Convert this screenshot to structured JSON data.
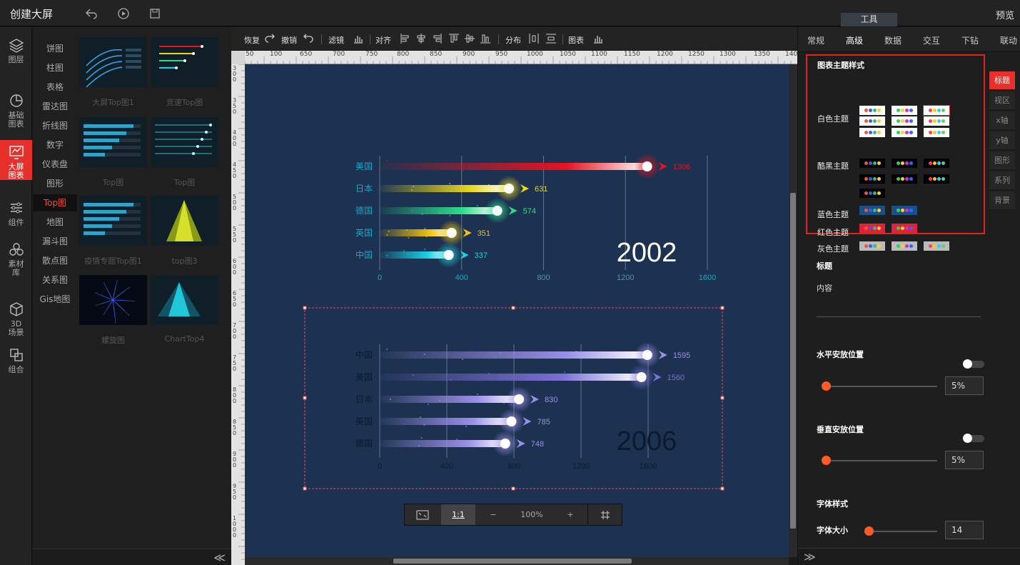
{
  "app": {
    "title": "创建大屏",
    "preview": "预览",
    "tools_tab": "工具",
    "undo_icon": "undo-icon",
    "play_icon": "play-icon",
    "save_icon": "save-icon"
  },
  "leftnav": [
    {
      "label": "图层",
      "icon": "layers-icon"
    },
    {
      "label": "基础图表",
      "icon": "clock-chart-icon"
    },
    {
      "label": "大屏图表",
      "icon": "screen-chart-icon",
      "active": true
    },
    {
      "label": "组件",
      "icon": "sliders-icon"
    },
    {
      "label": "素材库",
      "icon": "material-icon"
    },
    {
      "label": "3D场景",
      "icon": "cube-icon"
    },
    {
      "label": "组合",
      "icon": "group-icon"
    }
  ],
  "categories": [
    "饼图",
    "柱图",
    "表格",
    "雷达图",
    "折线图",
    "数字",
    "仪表盘",
    "图形",
    "Top图",
    "地图",
    "漏斗图",
    "散点图",
    "关系图",
    "Gis地图"
  ],
  "active_category": "Top图",
  "thumbnails": [
    "大屏Top图1",
    "竞速Top图",
    "Top图",
    "Top图",
    "疫情专题Top图1",
    "top图3",
    "螺旋图",
    "ChartTop4"
  ],
  "toolbar": {
    "redo": "恢复",
    "undo": "撤销",
    "filter": "滤镜",
    "align": "对齐",
    "distribute": "分布",
    "chart": "图表"
  },
  "ruler": {
    "top": [
      "50",
      "100",
      "650",
      "700",
      "750",
      "800",
      "850",
      "900",
      "950",
      "1000",
      "1050",
      "1100",
      "1150",
      "1200",
      "1250",
      "1300",
      "1350",
      "140"
    ],
    "left": [
      "300",
      "350",
      "400",
      "450",
      "500",
      "550",
      "600",
      "650",
      "700",
      "750",
      "800",
      "850",
      "900",
      "950",
      "1000"
    ]
  },
  "zoom": {
    "fit": "fit-screen-icon",
    "one": "1:1",
    "minus": "−",
    "level": "100%",
    "plus": "+",
    "grid": "grid-icon"
  },
  "chart_data": [
    {
      "type": "bar",
      "title": "2002",
      "categories": [
        "美国",
        "日本",
        "德国",
        "英国",
        "中国"
      ],
      "values": [
        1306,
        631,
        574,
        351,
        337
      ],
      "colors": [
        "#e8131f",
        "#e8d61b",
        "#2bdc8a",
        "#f1c40f",
        "#17d3e6"
      ],
      "xlim": [
        0,
        1600
      ],
      "xticks": [
        "0",
        "400",
        "800",
        "1200",
        "1600"
      ],
      "label_color": "#1aa6c9"
    },
    {
      "type": "bar",
      "title": "2006",
      "categories": [
        "中国",
        "美国",
        "日本",
        "英国",
        "德国"
      ],
      "values": [
        1595,
        1560,
        830,
        785,
        748
      ],
      "colors": [
        "#9b8ee8",
        "#7d6fd6",
        "#9b8ee8",
        "#9b8ee8",
        "#9b8ee8"
      ],
      "xlim": [
        0,
        1600
      ],
      "xticks": [
        "0",
        "400",
        "800",
        "1200",
        "1600"
      ],
      "label_color": "#0b1a2e"
    }
  ],
  "right": {
    "tabs": [
      "常规",
      "高级",
      "数据",
      "交互",
      "下钻",
      "联动"
    ],
    "active_tab": "高级",
    "theme_title": "图表主题样式",
    "themes": [
      {
        "label": "白色主题"
      },
      {
        "label": "酷黑主题"
      },
      {
        "label": "蓝色主题"
      },
      {
        "label": "红色主题"
      },
      {
        "label": "灰色主题"
      }
    ],
    "sidetabs": [
      "标题",
      "视区",
      "x轴",
      "y轴",
      "图形",
      "系列",
      "背景"
    ],
    "title_section": "标题",
    "content": "内容",
    "h_pos": "水平安放位置",
    "h_val": "5%",
    "v_pos": "垂直安放位置",
    "v_val": "5%",
    "font_style": "字体样式",
    "font_size": "字体大小",
    "font_val": "14"
  }
}
